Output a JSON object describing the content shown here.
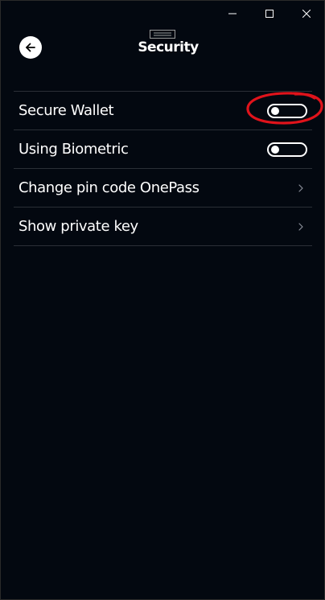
{
  "window": {
    "minimize_icon": "minimize-icon",
    "maximize_icon": "maximize-icon",
    "close_icon": "close-icon"
  },
  "header": {
    "back_icon": "arrow-left-icon",
    "title": "Security"
  },
  "settings": [
    {
      "label": "Secure Wallet",
      "control": "toggle",
      "enabled": false
    },
    {
      "label": "Using Biometric",
      "control": "toggle",
      "enabled": false
    },
    {
      "label": "Change pin code OnePass",
      "control": "chevron",
      "icon": "chevron-right-icon"
    },
    {
      "label": "Show private key",
      "control": "chevron",
      "icon": "chevron-right-icon"
    }
  ],
  "colors": {
    "background": "#030810",
    "text": "#ffffff",
    "divider": "#2b2f36",
    "annotation": "#e0131b"
  }
}
